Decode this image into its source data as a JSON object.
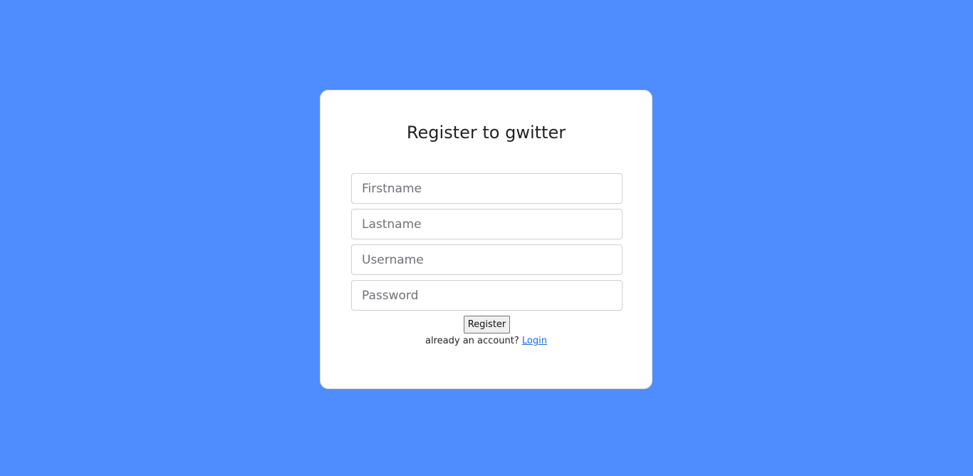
{
  "form": {
    "title": "Register to gwitter",
    "fields": [
      {
        "placeholder": "Firstname",
        "value": ""
      },
      {
        "placeholder": "Lastname",
        "value": ""
      },
      {
        "placeholder": "Username",
        "value": ""
      },
      {
        "placeholder": "Password",
        "value": ""
      }
    ],
    "submit_label": "Register",
    "footer_text": "already an account?",
    "login_link": "Login"
  },
  "colors": {
    "background": "#4f8cfd",
    "card": "#ffffff",
    "link": "#1a6ae0"
  }
}
